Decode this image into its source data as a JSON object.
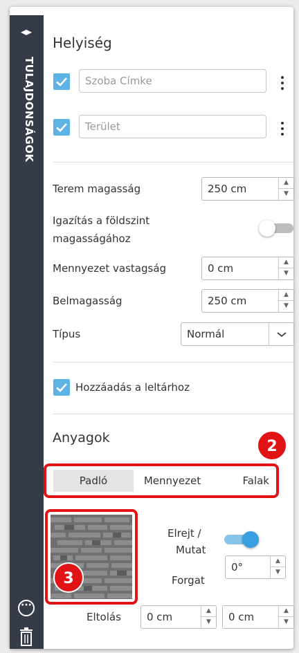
{
  "panel": {
    "side_tab_label": "TULAJDONSÁGOK",
    "room": {
      "title": "Helyiség",
      "name_label_field": {
        "placeholder": "Szoba Címke",
        "checked": true
      },
      "area_field": {
        "placeholder": "Terület",
        "checked": true
      }
    },
    "properties": {
      "room_height": {
        "label": "Terem magasság",
        "value": "250 cm"
      },
      "align_floor": {
        "label_line1": "Igazítás a földszint",
        "label_line2": "magasságához",
        "enabled": false
      },
      "ceiling_thickness": {
        "label": "Mennyezet vastagság",
        "value": "0 cm"
      },
      "inner_height": {
        "label": "Belmagasság",
        "value": "250 cm"
      },
      "type": {
        "label": "Típus",
        "value": "Normál"
      }
    },
    "inventory": {
      "label": "Hozzáadás a leltárhoz",
      "checked": true
    },
    "materials": {
      "title": "Anyagok",
      "tabs": [
        {
          "label": "Padló",
          "active": true
        },
        {
          "label": "Mennyezet",
          "active": false
        },
        {
          "label": "Falak",
          "active": false
        }
      ],
      "show_hide_line1": "Elrejt /",
      "show_hide_line2": "Mutat",
      "show_enabled": true,
      "rotate_label": "Forgat",
      "rotate_value": "0°",
      "offset_label": "Eltolás",
      "offset_x": "0 cm",
      "offset_y": "0 cm"
    },
    "annotations": {
      "badge_tabs": "2",
      "badge_swatch": "3"
    }
  },
  "colors": {
    "accent": "#5cb3e4",
    "sidebar": "#363b48",
    "highlight": "#e01414",
    "toggle_on": "#3a9fe0"
  }
}
